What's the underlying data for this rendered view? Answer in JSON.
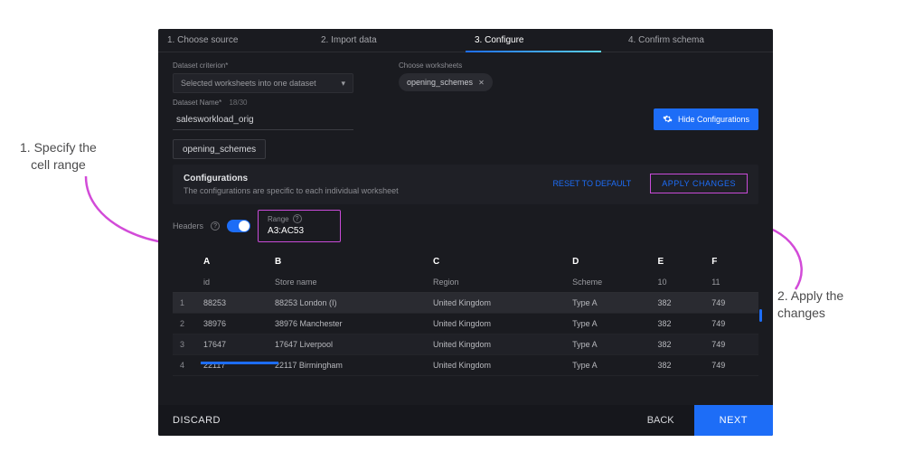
{
  "accent": "#1d6df7",
  "highlight_border": "#c84bd8",
  "steps": [
    "1. Choose source",
    "2. Import data",
    "3. Configure",
    "4. Confirm schema"
  ],
  "active_step_index": 2,
  "form": {
    "criterion_label": "Dataset criterion*",
    "criterion_value": "Selected worksheets into one dataset",
    "worksheets_label": "Choose worksheets",
    "worksheet_chip": "opening_schemes",
    "name_label": "Dataset Name*",
    "name_value": "salesworkload_orig",
    "name_count": "18/30",
    "hide_conf_label": "Hide Configurations"
  },
  "ws_tab": "opening_schemes",
  "cfg": {
    "title": "Configurations",
    "sub": "The configurations are specific to each individual worksheet",
    "reset": "RESET TO DEFAULT",
    "apply": "APPLY CHANGES",
    "headers_label": "Headers",
    "range_label": "Range",
    "range_value": "A3:AC53"
  },
  "table": {
    "cols": [
      "A",
      "B",
      "C",
      "D",
      "E",
      "F"
    ],
    "headers": [
      "id",
      "Store name",
      "Region",
      "Scheme",
      "10",
      "11"
    ],
    "rows": [
      {
        "n": "1",
        "c": [
          "88253",
          "88253 London (I)",
          "United Kingdom",
          "Type A",
          "382",
          "749"
        ]
      },
      {
        "n": "2",
        "c": [
          "38976",
          "38976 Manchester",
          "United Kingdom",
          "Type A",
          "382",
          "749"
        ]
      },
      {
        "n": "3",
        "c": [
          "17647",
          "17647 Liverpool",
          "United Kingdom",
          "Type A",
          "382",
          "749"
        ]
      },
      {
        "n": "4",
        "c": [
          "22117",
          "22117 Birmingham",
          "United Kingdom",
          "Type A",
          "382",
          "749"
        ]
      }
    ]
  },
  "footer": {
    "discard": "DISCARD",
    "back": "BACK",
    "next": "NEXT"
  },
  "annotations": {
    "a1_line1": "1. Specify the",
    "a1_line2": "cell range",
    "a2_line1": "2. Apply the",
    "a2_line2": "changes"
  }
}
